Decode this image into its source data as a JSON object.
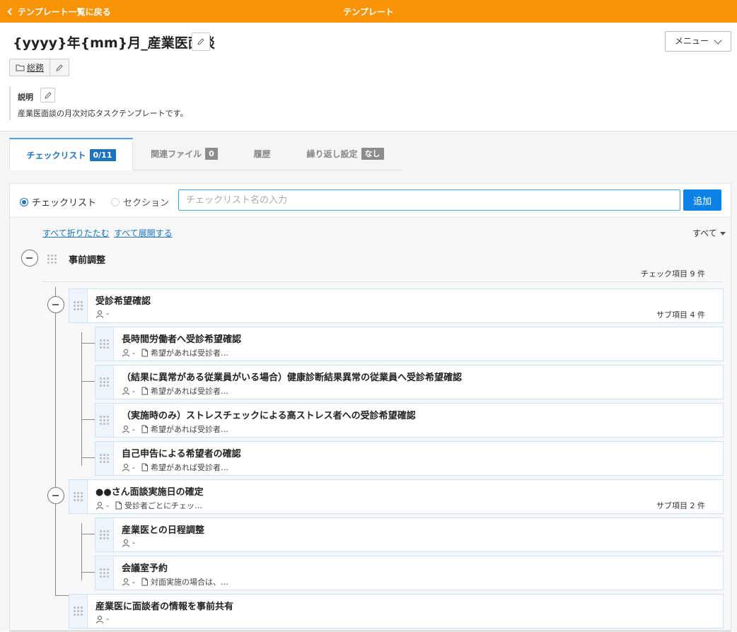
{
  "topbar": {
    "back_label": "テンプレート一覧に戻る",
    "title": "テンプレート",
    "color": "#f89406"
  },
  "template": {
    "title": "{yyyy}年{mm}月_産業医面談",
    "menu_label": "メニュー",
    "folder": "総務",
    "desc_label": "説明",
    "description": "産業医面談の月次対応タスクテンプレートです。"
  },
  "tabs": [
    {
      "label": "チェックリスト",
      "badge": "0/11"
    },
    {
      "label": "関連ファイル",
      "badge": "0"
    },
    {
      "label": "履歴",
      "badge": ""
    },
    {
      "label": "繰り返し設定",
      "badge": "なし"
    }
  ],
  "form": {
    "radio_checklist": "チェックリスト",
    "radio_section": "セクション",
    "input_placeholder": "チェックリスト名の入力",
    "add_label": "追加"
  },
  "tree": {
    "collapse_all": "すべて折りたたむ",
    "expand_all": "すべて展開する",
    "filter": "すべて",
    "section": {
      "title": "事前調整",
      "count": "チェック項目 9 件"
    },
    "items": [
      {
        "title": "受診希望確認",
        "assignee": "-",
        "note": "",
        "sub": "サブ項目 4 件"
      },
      {
        "title": "長時間労働者へ受診希望確認",
        "assignee": "-",
        "note": "希望があれば受診者…",
        "sub": ""
      },
      {
        "title": "（結果に異常がある従業員がいる場合）健康診断結果異常の従業員へ受診希望確認",
        "assignee": "-",
        "note": "希望があれば受診者…",
        "sub": ""
      },
      {
        "title": "（実施時のみ）ストレスチェックによる高ストレス者への受診希望確認",
        "assignee": "-",
        "note": "希望があれば受診者…",
        "sub": ""
      },
      {
        "title": "自己申告による希望者の確認",
        "assignee": "-",
        "note": "希望があれば受診者…",
        "sub": ""
      },
      {
        "title": "●●さん面談実施日の確定",
        "assignee": "-",
        "note": "受診者ごとにチェッ…",
        "sub": "サブ項目 2 件"
      },
      {
        "title": "産業医との日程調整",
        "assignee": "-",
        "note": "",
        "sub": ""
      },
      {
        "title": "会議室予約",
        "assignee": "-",
        "note": "対面実施の場合は、…",
        "sub": ""
      },
      {
        "title": "産業医に面談者の情報を事前共有",
        "assignee": "-",
        "note": "",
        "sub": ""
      }
    ]
  }
}
